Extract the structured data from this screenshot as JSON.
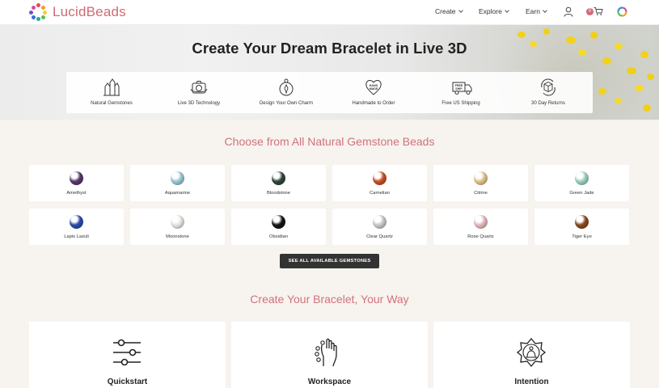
{
  "header": {
    "brand": "LucidBeads",
    "nav": [
      {
        "label": "Create"
      },
      {
        "label": "Explore"
      },
      {
        "label": "Earn"
      }
    ],
    "cart_count": "0",
    "icons": [
      "user-icon",
      "cart-icon",
      "color-wheel-icon"
    ]
  },
  "hero": {
    "title": "Create Your Dream Bracelet in Live 3D",
    "features": [
      {
        "label": "Natural Gemstones",
        "icon": "crystal-icon"
      },
      {
        "label": "Live 3D Technology",
        "icon": "3d-camera-icon"
      },
      {
        "label": "Design Your Own Charm",
        "icon": "charm-icon"
      },
      {
        "label": "Handmade to Order",
        "icon": "handmade-heart-icon",
        "badge": "HAND MADE"
      },
      {
        "label": "Free US Shipping",
        "icon": "truck-icon",
        "badge": "FREE SHIP"
      },
      {
        "label": "30 Day Returns",
        "icon": "return-box-icon"
      }
    ]
  },
  "gemstones": {
    "title": "Choose from All Natural Gemstone Beads",
    "items": [
      {
        "name": "Amethyst",
        "color": "#5a3a6b"
      },
      {
        "name": "Aquamarine",
        "color": "#9cc8d6"
      },
      {
        "name": "Bloodstone",
        "color": "#34473c"
      },
      {
        "name": "Carnelian",
        "color": "#c8522a"
      },
      {
        "name": "Citrine",
        "color": "#e2c48c"
      },
      {
        "name": "Green Jade",
        "color": "#9fd2c0"
      },
      {
        "name": "Lapis Lazuli",
        "color": "#2a4fa8"
      },
      {
        "name": "Moonstone",
        "color": "#e6e6e2"
      },
      {
        "name": "Obsidian",
        "color": "#151515"
      },
      {
        "name": "Clear Quartz",
        "color": "#c9c9c9"
      },
      {
        "name": "Rose Quartz",
        "color": "#e3b9bd"
      },
      {
        "name": "Tiger Eye",
        "color": "#8a4a1e"
      }
    ],
    "button_label": "SEE ALL AVAILABLE GEMSTONES"
  },
  "create": {
    "title": "Create Your Bracelet, Your Way",
    "cards": [
      {
        "label": "Quickstart",
        "icon": "sliders-icon"
      },
      {
        "label": "Workspace",
        "icon": "hand-beads-icon"
      },
      {
        "label": "Intention",
        "icon": "meditation-icon"
      }
    ]
  },
  "colors": {
    "accent": "#cf6a74",
    "button": "#333333",
    "background": "#f7f3ef"
  }
}
